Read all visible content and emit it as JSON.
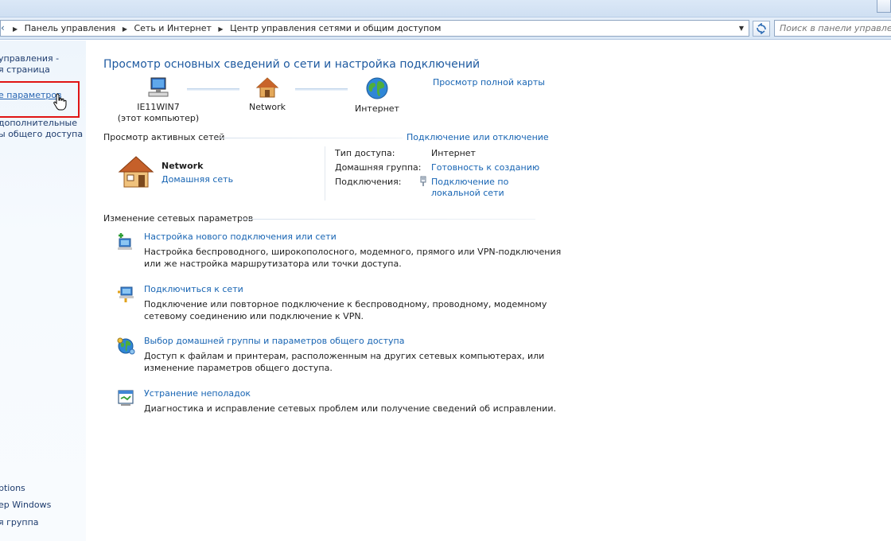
{
  "address_bar": {
    "breadcrumbs": [
      "Панель управления",
      "Сеть и Интернет",
      "Центр управления сетями и общим доступом"
    ],
    "search_placeholder": "Поиск в панели управления"
  },
  "left_pane": {
    "items": [
      {
        "label": "управления -"
      },
      {
        "label": "я страница"
      },
      {
        "label": "е параметров"
      },
      {
        "label": "дополнительные"
      },
      {
        "label": "ы общего доступа"
      }
    ],
    "bottom_items": [
      {
        "label": "ptions"
      },
      {
        "label": "ер Windows"
      },
      {
        "label": "я группа"
      }
    ]
  },
  "main": {
    "heading": "Просмотр основных сведений о сети и настройка подключений",
    "full_map_link": "Просмотр полной карты",
    "map": {
      "computer_name": "IE11WIN7",
      "computer_sub": "(этот компьютер)",
      "network": "Network",
      "internet": "Интернет"
    },
    "active_networks": {
      "header": "Просмотр активных сетей",
      "connect_link": "Подключение или отключение",
      "network_name": "Network",
      "network_type": "Домашняя сеть",
      "access_type_label": "Тип доступа:",
      "access_type_value": "Интернет",
      "homegroup_label": "Домашняя группа:",
      "homegroup_value": "Готовность к созданию",
      "connections_label": "Подключения:",
      "connections_value_1": "Подключение по",
      "connections_value_2": "локальной сети"
    },
    "change_settings": {
      "header": "Изменение сетевых параметров",
      "tasks": [
        {
          "title": "Настройка нового подключения или сети",
          "desc1": "Настройка беспроводного, широкополосного, модемного, прямого или VPN-подключения",
          "desc2": "или же настройка маршрутизатора или точки доступа."
        },
        {
          "title": "Подключиться к сети",
          "desc1": "Подключение или повторное подключение к беспроводному, проводному, модемному",
          "desc2": "сетевому соединению или подключение к VPN."
        },
        {
          "title": "Выбор домашней группы и параметров общего доступа",
          "desc1": "Доступ к файлам и принтерам, расположенным на других сетевых компьютерах, или",
          "desc2": "изменение параметров общего доступа."
        },
        {
          "title": "Устранение неполадок",
          "desc1": "Диагностика и исправление сетевых проблем или получение сведений об исправлении.",
          "desc2": ""
        }
      ]
    }
  }
}
